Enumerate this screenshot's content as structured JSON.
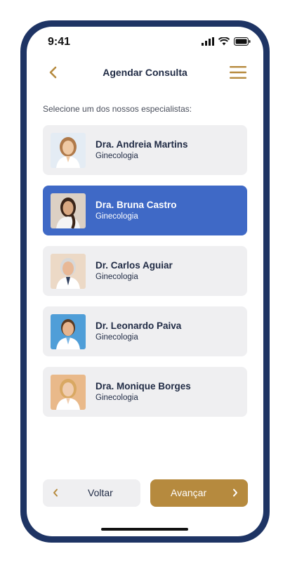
{
  "status": {
    "time": "9:41"
  },
  "header": {
    "title": "Agendar Consulta"
  },
  "subtitle": "Selecione um dos nossos especialistas:",
  "doctors": [
    {
      "name": "Dra. Andreia Martins",
      "specialty": "Ginecologia",
      "selected": false
    },
    {
      "name": "Dra. Bruna Castro",
      "specialty": "Ginecologia",
      "selected": true
    },
    {
      "name": "Dr. Carlos Aguiar",
      "specialty": "Ginecologia",
      "selected": false
    },
    {
      "name": "Dr. Leonardo Paiva",
      "specialty": "Ginecologia",
      "selected": false
    },
    {
      "name": "Dra. Monique Borges",
      "specialty": "Ginecologia",
      "selected": false
    }
  ],
  "actions": {
    "back_label": "Voltar",
    "next_label": "Avançar"
  },
  "colors": {
    "primary": "#3f69c6",
    "accent": "#b68a3e",
    "frame": "#1e3464",
    "card_bg": "#efeff1",
    "text_dark": "#1f2a44"
  },
  "icons": {
    "back": "chevron-left-icon",
    "menu": "hamburger-menu-icon",
    "signal": "signal-icon",
    "wifi": "wifi-icon",
    "battery": "battery-icon"
  }
}
